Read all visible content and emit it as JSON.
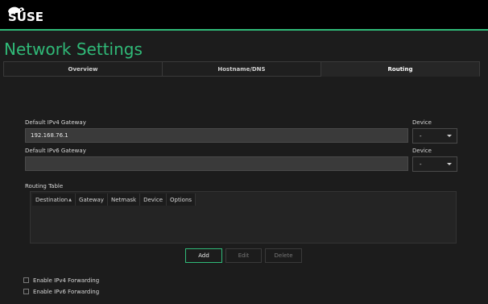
{
  "branding": {
    "logo_text": "SUSE"
  },
  "page": {
    "title": "Network Settings"
  },
  "tabs": [
    {
      "label": "Overview",
      "active": false
    },
    {
      "label": "Hostname/DNS",
      "active": false
    },
    {
      "label": "Routing",
      "active": true
    }
  ],
  "gateways": {
    "ipv4_label": "Default IPv4 Gateway",
    "ipv4_value": "192.168.76.1",
    "ipv4_device_label": "Device",
    "ipv4_device_value": "-",
    "ipv6_label": "Default IPv6 Gateway",
    "ipv6_value": "",
    "ipv6_device_label": "Device",
    "ipv6_device_value": "-"
  },
  "routing_table": {
    "label": "Routing Table",
    "columns": [
      "Destination",
      "Gateway",
      "Netmask",
      "Device",
      "Options"
    ],
    "rows": []
  },
  "actions": {
    "add": "Add",
    "edit": "Edit",
    "delete": "Delete"
  },
  "forwarding": {
    "ipv4_label": "Enable IPv4 Forwarding",
    "ipv4_checked": false,
    "ipv6_label": "Enable IPv6 Forwarding",
    "ipv6_checked": false
  },
  "colors": {
    "accent": "#30ba78",
    "background": "#1c1c1c",
    "topbar": "#000000"
  },
  "icons": {
    "logo": "suse-chameleon-icon",
    "dropdown": "chevron-down-icon",
    "sort": "sort-indicator-icon"
  }
}
